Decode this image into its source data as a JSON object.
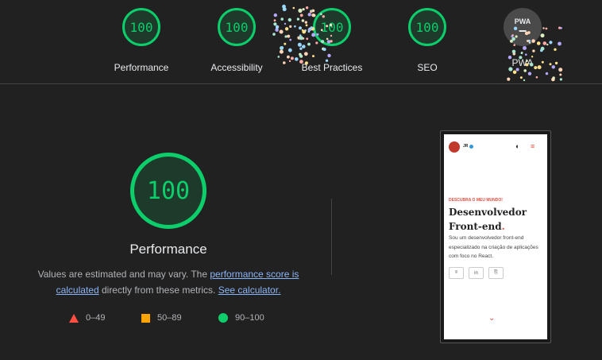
{
  "categories": [
    {
      "label": "Performance",
      "score": "100"
    },
    {
      "label": "Accessibility",
      "score": "100"
    },
    {
      "label": "Best Practices",
      "score": "100"
    },
    {
      "label": "SEO",
      "score": "100"
    },
    {
      "label": "PWA",
      "badge": "PWA"
    }
  ],
  "main": {
    "score": "100",
    "title": "Performance",
    "desc_prefix": "Values are estimated and may vary. The ",
    "desc_link1": "performance score is calculated",
    "desc_mid": " directly from these metrics. ",
    "desc_link2": "See calculator."
  },
  "legend": {
    "fail": "0–49",
    "average": "50–89",
    "pass": "90–100"
  },
  "screenshot": {
    "name": "JR",
    "kicker": "DESCUBRA O MEU MUNDO!",
    "heading_line1": "Desenvolvedor",
    "heading_line2": "Front-end",
    "heading_dot": ".",
    "body": "Sou um desenvolvedor front-end especializado na criação de aplicações com foco no React.",
    "icon1": "⌾",
    "icon2": "in",
    "icon3": "⎘",
    "chevron": "⌄"
  },
  "colors": {
    "pass": "#0cce6b",
    "average": "#ffa400",
    "fail": "#ff4e42",
    "background": "#212121",
    "link": "#8ab4f8"
  }
}
